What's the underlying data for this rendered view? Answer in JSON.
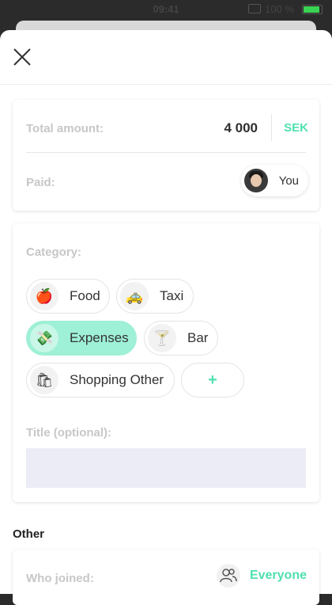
{
  "status_bar": {
    "time": "09:41",
    "battery": "100 %"
  },
  "form": {
    "total_label": "Total amount:",
    "total_value": "4 000",
    "currency": "SEK",
    "paid_label": "Paid:",
    "payer": "You",
    "category_label": "Category:",
    "categories": [
      {
        "label": "Food",
        "icon": "apple-icon",
        "glyph": "🍎",
        "selected": false
      },
      {
        "label": "Taxi",
        "icon": "taxi-icon",
        "glyph": "🚕",
        "selected": false
      },
      {
        "label": "Expenses",
        "icon": "money-icon",
        "glyph": "💸",
        "selected": true
      },
      {
        "label": "Bar",
        "icon": "cocktail-icon",
        "glyph": "🍸",
        "selected": false
      },
      {
        "label": "Shopping Other",
        "icon": "shopping-bag-icon",
        "glyph": "🛍",
        "selected": false
      }
    ],
    "add_label": "+",
    "title_label": "Title (optional):",
    "title_value": ""
  },
  "other": {
    "heading": "Other",
    "who_joined_label": "Who joined:",
    "who_joined_value": "Everyone"
  },
  "colors": {
    "accent": "#4fe0b0",
    "selected_chip": "#9ef0d6",
    "input_bg": "#ececf6"
  }
}
